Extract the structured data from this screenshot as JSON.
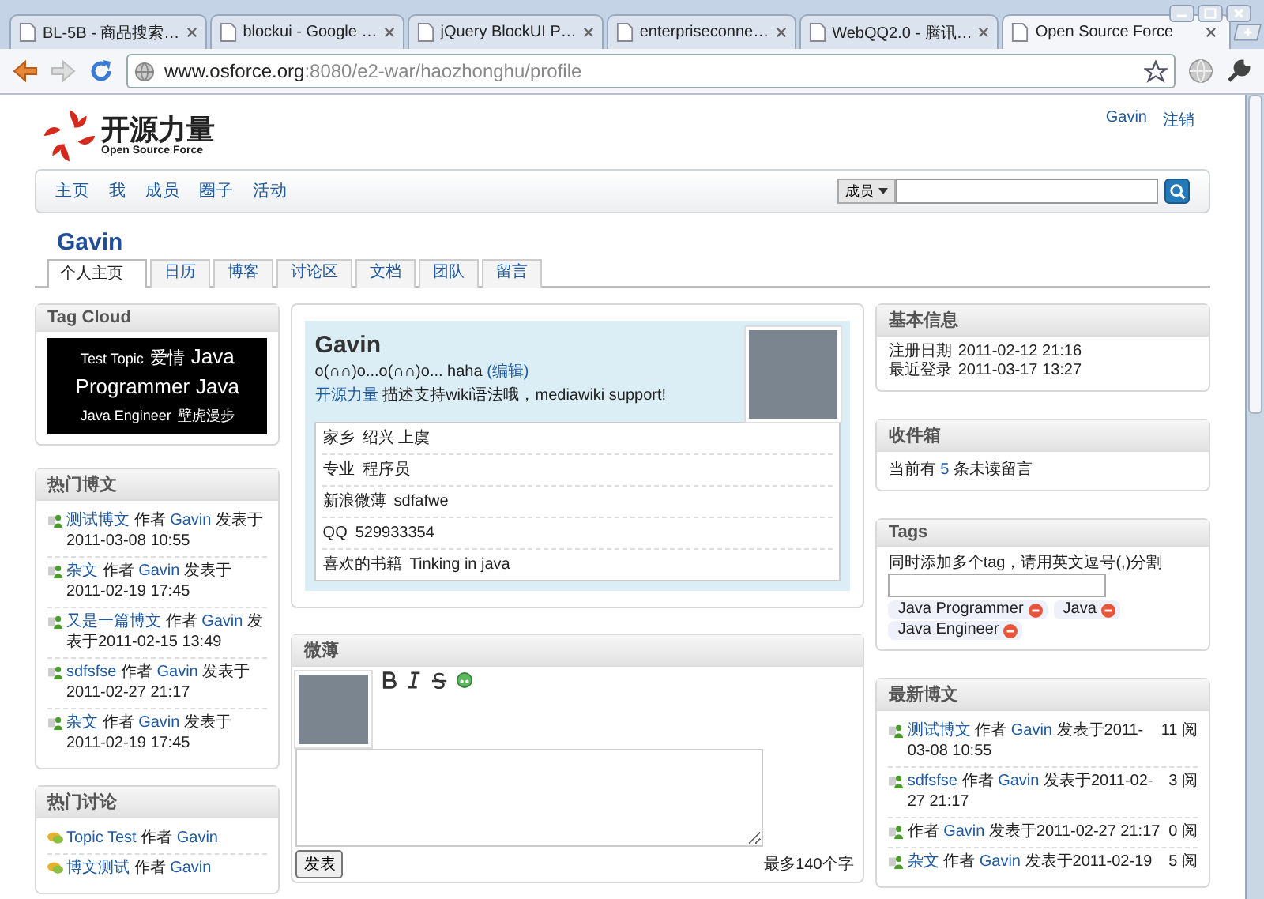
{
  "browser": {
    "tabs": [
      {
        "title": "BL-5B - 商品搜索…",
        "selected": false
      },
      {
        "title": "blockui - Google …",
        "selected": false
      },
      {
        "title": "jQuery BlockUI P…",
        "selected": false
      },
      {
        "title": "enterpriseconne…",
        "selected": false
      },
      {
        "title": "WebQQ2.0 - 腾讯…",
        "selected": false
      },
      {
        "title": "Open Source Force",
        "selected": true
      }
    ],
    "url": {
      "host": "www.osforce.org",
      "path": ":8080/e2-war/haozhonghu/profile"
    }
  },
  "header": {
    "logo_title": "开源力量",
    "logo_subtitle": "Open Source Force",
    "user_links": [
      "Gavin",
      "注销"
    ]
  },
  "nav": {
    "items": [
      "主页",
      "我",
      "成员",
      "圈子",
      "活动"
    ],
    "search_scope": "成员"
  },
  "profile": {
    "name": "Gavin",
    "tabs": [
      {
        "label": "个人主页",
        "selected": true
      },
      {
        "label": "日历",
        "selected": false
      },
      {
        "label": "博客",
        "selected": false
      },
      {
        "label": "讨论区",
        "selected": false
      },
      {
        "label": "文档",
        "selected": false
      },
      {
        "label": "团队",
        "selected": false
      },
      {
        "label": "留言",
        "selected": false
      }
    ]
  },
  "tag_cloud": {
    "title": "Tag Cloud",
    "tags": [
      {
        "label": "Test Topic",
        "kind": "small"
      },
      {
        "label": "爱情",
        "kind": "medium"
      },
      {
        "label": "Java",
        "kind": "large"
      },
      {
        "label": "Programmer",
        "kind": "large"
      },
      {
        "label": "Java",
        "kind": "large"
      },
      {
        "label": "Java Engineer",
        "kind": "small"
      },
      {
        "label": "壁虎漫步",
        "kind": "small"
      }
    ]
  },
  "hot_posts": {
    "title": "热门博文",
    "items": [
      {
        "title": "测试博文",
        "by": "作者",
        "author": "Gavin",
        "posted": "发表于2011-03-08 10:55"
      },
      {
        "title": "杂文",
        "by": "作者",
        "author": "Gavin",
        "posted": "发表于2011-02-19 17:45"
      },
      {
        "title": "又是一篇博文",
        "by": "作者",
        "author": "Gavin",
        "posted": "发表于2011-02-15 13:49"
      },
      {
        "title": "sdfsfse",
        "by": "作者",
        "author": "Gavin",
        "posted": "发表于2011-02-27 21:17"
      },
      {
        "title": "杂文",
        "by": "作者",
        "author": "Gavin",
        "posted": "发表于2011-02-19 17:45"
      }
    ]
  },
  "hot_topics": {
    "title": "热门讨论",
    "items": [
      {
        "title": "Topic Test",
        "by": "作者",
        "author": "Gavin"
      },
      {
        "title": "博文测试",
        "by": "作者",
        "author": "Gavin"
      }
    ]
  },
  "card": {
    "name": "Gavin",
    "status": "o(∩∩)o...o(∩∩)o... haha",
    "edit_link": "(编辑)",
    "site_link": "开源力量",
    "description": "描述支持wiki语法哦，mediawiki support!",
    "info": [
      {
        "label": "家乡",
        "value": "绍兴 上虞"
      },
      {
        "label": "专业",
        "value": "程序员"
      },
      {
        "label": "新浪微薄",
        "value": "sdfafwe"
      },
      {
        "label": "QQ",
        "value": "529933354"
      },
      {
        "label": "喜欢的书籍",
        "value": "Tinking in java"
      }
    ]
  },
  "weibo": {
    "title": "微薄",
    "submit": "发表",
    "hint": "最多140个字"
  },
  "basic_info": {
    "title": "基本信息",
    "rows": [
      {
        "label": "注册日期",
        "value": "2011-02-12 21:16"
      },
      {
        "label": "最近登录",
        "value": "2011-03-17 13:27"
      }
    ]
  },
  "inbox": {
    "title": "收件箱",
    "prefix": "当前有",
    "count": "5",
    "suffix": "条未读留言"
  },
  "tags": {
    "title": "Tags",
    "hint": "同时添加多个tag，请用英文逗号(,)分割",
    "chips": [
      "Java Programmer",
      "Java",
      "Java Engineer"
    ]
  },
  "latest_posts": {
    "title": "最新博文",
    "items": [
      {
        "title": "测试博文",
        "by": "作者",
        "author": "Gavin",
        "posted": "发表于2011-03-08 10:55",
        "reads": "11 阅"
      },
      {
        "title": "sdfsfse",
        "by": "作者",
        "author": "Gavin",
        "posted": "发表于2011-02-27 21:17",
        "reads": "3 阅"
      },
      {
        "by": "作者",
        "author": "Gavin",
        "posted": "发表于2011-02-27 21:17",
        "reads": "0 阅"
      },
      {
        "title": "杂文",
        "by": "作者",
        "author": "Gavin",
        "posted": "发表于2011-02-19",
        "reads": "5 阅"
      }
    ]
  }
}
